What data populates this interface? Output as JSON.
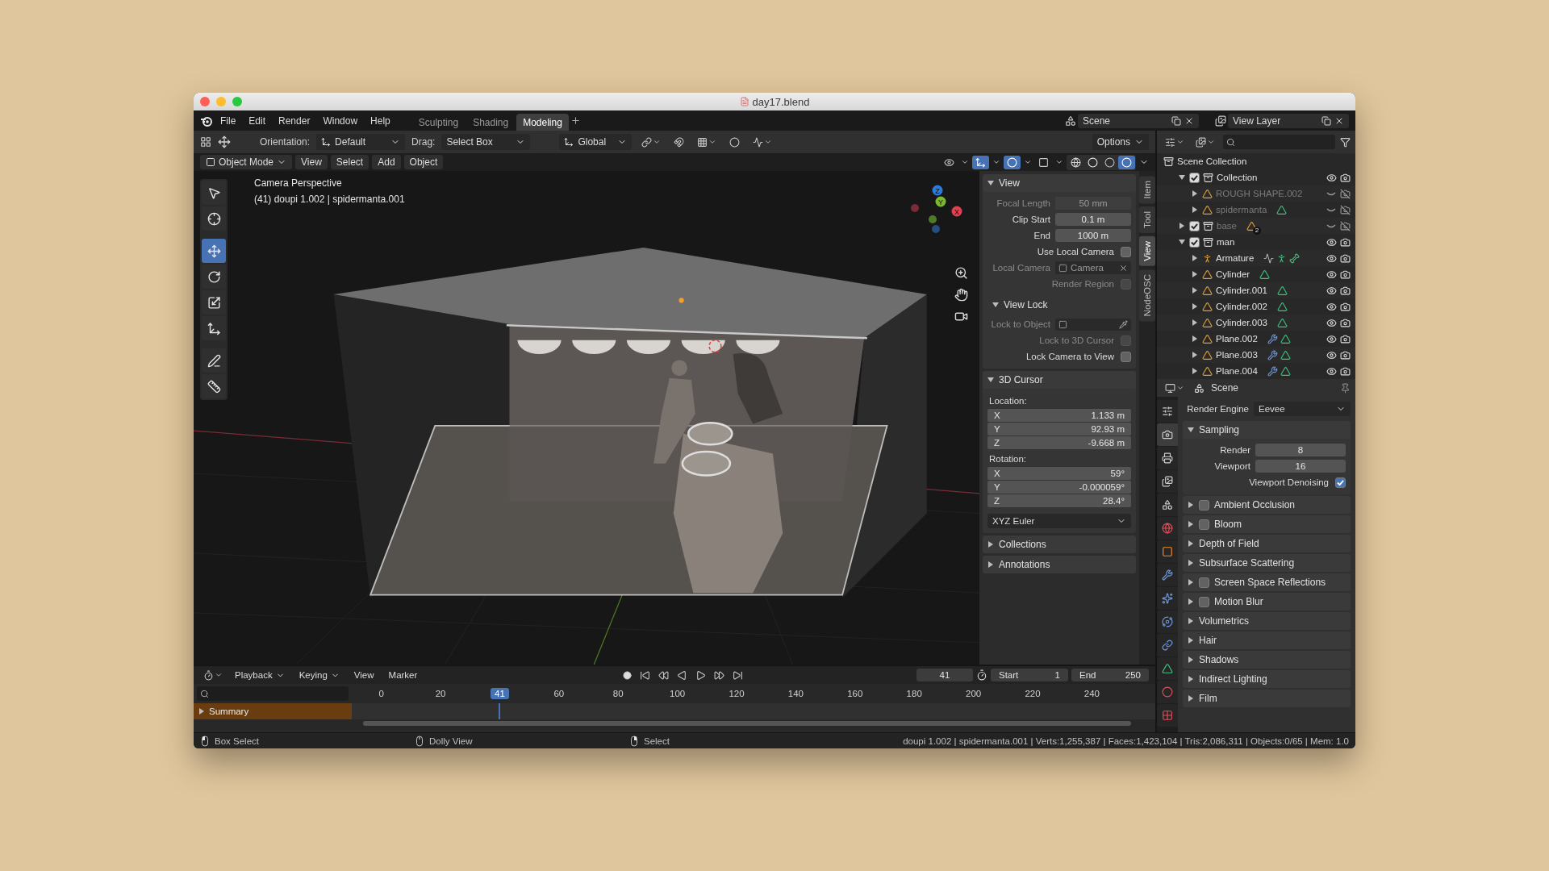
{
  "window": {
    "title": "day17.blend"
  },
  "menu_bar": {
    "menus": [
      "File",
      "Edit",
      "Render",
      "Window",
      "Help"
    ],
    "workspaces": [
      {
        "label": "Sculpting",
        "selected": false
      },
      {
        "label": "Shading",
        "selected": false
      },
      {
        "label": "Modeling",
        "selected": true
      }
    ],
    "scene": "Scene",
    "view_layer": "View Layer"
  },
  "tool_header": {
    "orientation_label": "Orientation:",
    "orientation": "Default",
    "drag_label": "Drag:",
    "drag": "Select Box",
    "transform_space": "Global",
    "options": "Options"
  },
  "viewport_header": {
    "mode": "Object Mode",
    "menus": [
      "View",
      "Select",
      "Add",
      "Object"
    ],
    "toggles": [
      {
        "kind": "visibility",
        "on": false
      },
      {
        "kind": "gizmo",
        "on": true
      },
      {
        "kind": "overlay",
        "on": true
      },
      {
        "kind": "xray",
        "on": false
      }
    ],
    "shading": [
      {
        "kind": "wireframe",
        "selected": false
      },
      {
        "kind": "solid",
        "selected": false
      },
      {
        "kind": "material",
        "selected": false
      },
      {
        "kind": "rendered",
        "selected": true
      }
    ]
  },
  "toolbar": [
    {
      "kind": "select_box",
      "selected": false
    },
    {
      "kind": "cursor",
      "selected": false
    },
    {
      "kind": "move",
      "selected": true
    },
    {
      "kind": "rotate",
      "selected": false
    },
    {
      "kind": "scale",
      "selected": false
    },
    {
      "kind": "transform",
      "selected": false
    },
    {
      "kind": "annotate",
      "selected": false
    },
    {
      "kind": "measure",
      "selected": false
    }
  ],
  "viewport": {
    "overlay_lines": [
      "Camera Perspective",
      "(41) doupi 1.002 | spidermanta.001"
    ],
    "gizmo": [
      {
        "label": "Z",
        "color": "#2e7ad8"
      },
      {
        "label": "Y",
        "color": "#7cb82f"
      },
      {
        "label": "X",
        "color": "#e0404f"
      }
    ]
  },
  "sidebar": {
    "tabs": [
      {
        "label": "Item",
        "selected": false
      },
      {
        "label": "Tool",
        "selected": false
      },
      {
        "label": "View",
        "selected": true
      },
      {
        "label": "NodeOSC",
        "selected": false
      }
    ],
    "panels": [
      {
        "title": "View",
        "expanded": true,
        "fields": [
          {
            "kind": "number",
            "label": "Focal Length",
            "value": "50 mm",
            "disabled": true
          },
          {
            "kind": "number",
            "label": "Clip Start",
            "value": "0.1 m",
            "disabled": false
          },
          {
            "kind": "number",
            "label": "End",
            "value": "1000 m",
            "disabled": false
          },
          {
            "kind": "checkbox",
            "label": "Use Local Camera",
            "checked": false,
            "disabled": false
          },
          {
            "kind": "object",
            "label": "Local Camera",
            "value": "Camera",
            "disabled": true
          },
          {
            "kind": "checkbox",
            "label": "Render Region",
            "checked": false,
            "disabled": true
          },
          {
            "kind": "subpanel",
            "label": "View Lock",
            "expanded": true
          },
          {
            "kind": "object",
            "label": "Lock to Object",
            "disabled": true
          },
          {
            "kind": "checkbox",
            "label": "Lock to 3D Cursor",
            "checked": false,
            "disabled": true
          },
          {
            "kind": "checkbox",
            "label": "Lock Camera to View",
            "checked": false,
            "disabled": false
          }
        ]
      },
      {
        "title": "3D Cursor",
        "expanded": true,
        "fields": [
          {
            "kind": "heading",
            "label": "Location:"
          },
          {
            "kind": "vector",
            "rows": [
              {
                "axis": "X",
                "value": "1.133 m"
              },
              {
                "axis": "Y",
                "value": "92.93 m"
              },
              {
                "axis": "Z",
                "value": "-9.668 m"
              }
            ]
          },
          {
            "kind": "heading",
            "label": "Rotation:"
          },
          {
            "kind": "vector",
            "rows": [
              {
                "axis": "X",
                "value": "59°"
              },
              {
                "axis": "Y",
                "value": "-0.000059°"
              },
              {
                "axis": "Z",
                "value": "28.4°"
              }
            ]
          },
          {
            "kind": "dropdown",
            "value": "XYZ Euler"
          }
        ]
      },
      {
        "title": "Collections",
        "expanded": false
      },
      {
        "title": "Annotations",
        "expanded": false
      }
    ]
  },
  "outliner": {
    "root": "Scene Collection",
    "tree": [
      {
        "name": "Collection",
        "kind": "collection",
        "expanded": true,
        "checked": true,
        "visible": true,
        "renderable": true,
        "children": [
          {
            "name": "ROUGH SHAPE.002",
            "kind": "mesh",
            "expanded": false,
            "visible": false,
            "renderable": false
          },
          {
            "name": "spidermanta",
            "kind": "mesh",
            "expanded": false,
            "visible": false,
            "renderable": false,
            "extras": [
              {
                "kind": "mesh"
              }
            ]
          }
        ]
      },
      {
        "name": "base",
        "kind": "collection",
        "expanded": false,
        "checked": true,
        "visible": false,
        "renderable": false,
        "extras": [
          {
            "kind": "objects",
            "count": "2"
          }
        ]
      },
      {
        "name": "man",
        "kind": "collection",
        "expanded": true,
        "checked": true,
        "visible": true,
        "renderable": true,
        "children": [
          {
            "name": "Armature",
            "kind": "armature",
            "expanded": false,
            "visible": true,
            "renderable": true,
            "extras": [
              {
                "kind": "action"
              },
              {
                "kind": "pose"
              },
              {
                "kind": "armature"
              }
            ]
          },
          {
            "name": "Cylinder",
            "kind": "mesh",
            "expanded": false,
            "visible": true,
            "renderable": true,
            "extras": [
              {
                "kind": "mesh"
              }
            ]
          },
          {
            "name": "Cylinder.001",
            "kind": "mesh",
            "expanded": false,
            "visible": true,
            "renderable": true,
            "extras": [
              {
                "kind": "mesh"
              }
            ]
          },
          {
            "name": "Cylinder.002",
            "kind": "mesh",
            "expanded": false,
            "visible": true,
            "renderable": true,
            "extras": [
              {
                "kind": "mesh"
              }
            ]
          },
          {
            "name": "Cylinder.003",
            "kind": "mesh",
            "expanded": false,
            "visible": true,
            "renderable": true,
            "extras": [
              {
                "kind": "mesh"
              }
            ]
          },
          {
            "name": "Plane.002",
            "kind": "mesh",
            "expanded": false,
            "visible": true,
            "renderable": true,
            "extras": [
              {
                "kind": "modifier"
              },
              {
                "kind": "mesh"
              }
            ]
          },
          {
            "name": "Plane.003",
            "kind": "mesh",
            "expanded": false,
            "visible": true,
            "renderable": true,
            "extras": [
              {
                "kind": "modifier"
              },
              {
                "kind": "mesh"
              }
            ]
          },
          {
            "name": "Plane.004",
            "kind": "mesh",
            "expanded": false,
            "visible": true,
            "renderable": true,
            "extras": [
              {
                "kind": "modifier"
              },
              {
                "kind": "mesh"
              }
            ]
          }
        ]
      }
    ]
  },
  "properties": {
    "context": "Scene",
    "tabs": [
      {
        "kind": "tool",
        "selected": false
      },
      {
        "kind": "render",
        "selected": true
      },
      {
        "kind": "output",
        "selected": false
      },
      {
        "kind": "view_layer",
        "selected": false
      },
      {
        "kind": "scene",
        "selected": false
      },
      {
        "kind": "world",
        "selected": false
      },
      {
        "kind": "object",
        "selected": false
      },
      {
        "kind": "modifiers",
        "selected": false
      },
      {
        "kind": "particles",
        "selected": false
      },
      {
        "kind": "physics",
        "selected": false
      },
      {
        "kind": "constraints",
        "selected": false
      },
      {
        "kind": "data",
        "selected": false
      },
      {
        "kind": "material",
        "selected": false
      },
      {
        "kind": "texture",
        "selected": false
      }
    ],
    "render_engine": {
      "label": "Render Engine",
      "value": "Eevee"
    },
    "panels": [
      {
        "title": "Sampling",
        "expanded": true,
        "fields": [
          {
            "kind": "number",
            "label": "Render",
            "value": "8"
          },
          {
            "kind": "number",
            "label": "Viewport",
            "value": "16"
          },
          {
            "kind": "checkbox",
            "label": "Viewport Denoising",
            "checked": true
          }
        ]
      },
      {
        "title": "Ambient Occlusion",
        "expanded": false,
        "enabled": false
      },
      {
        "title": "Bloom",
        "expanded": false,
        "enabled": false
      },
      {
        "title": "Depth of Field",
        "expanded": false
      },
      {
        "title": "Subsurface Scattering",
        "expanded": false
      },
      {
        "title": "Screen Space Reflections",
        "expanded": false,
        "enabled": false
      },
      {
        "title": "Motion Blur",
        "expanded": false,
        "enabled": false
      },
      {
        "title": "Volumetrics",
        "expanded": false
      },
      {
        "title": "Hair",
        "expanded": false
      },
      {
        "title": "Shadows",
        "expanded": false
      },
      {
        "title": "Indirect Lighting",
        "expanded": false
      },
      {
        "title": "Film",
        "expanded": false
      }
    ]
  },
  "timeline": {
    "menus": [
      {
        "label": "Playback",
        "dropdown": true
      },
      {
        "label": "Keying",
        "dropdown": true
      },
      {
        "label": "View",
        "dropdown": false
      },
      {
        "label": "Marker",
        "dropdown": false
      }
    ],
    "current_frame": "41",
    "start_label": "Start",
    "start": "1",
    "end_label": "End",
    "end": "250",
    "ruler": [
      {
        "kind": "tick",
        "label": "0"
      },
      {
        "kind": "tick",
        "label": "20"
      },
      {
        "kind": "playhead",
        "label": "41"
      },
      {
        "kind": "tick",
        "label": "60"
      },
      {
        "kind": "tick",
        "label": "80"
      },
      {
        "kind": "tick",
        "label": "100"
      },
      {
        "kind": "tick",
        "label": "120"
      },
      {
        "kind": "tick",
        "label": "140"
      },
      {
        "kind": "tick",
        "label": "160"
      },
      {
        "kind": "tick",
        "label": "180"
      },
      {
        "kind": "tick",
        "label": "200"
      },
      {
        "kind": "tick",
        "label": "220"
      },
      {
        "kind": "tick",
        "label": "240"
      }
    ],
    "channels": [
      {
        "label": "Summary",
        "expanded": false
      }
    ]
  },
  "status_bar": {
    "hints": [
      {
        "kind": "mouse_left",
        "label": "Box Select"
      },
      {
        "kind": "mouse_middle",
        "label": "Dolly View"
      },
      {
        "kind": "mouse_right",
        "label": "Select"
      }
    ],
    "stats": "doupi 1.002 | spidermanta.001 | Verts:1,255,387 | Faces:1,423,104 | Tris:2,086,311 | Objects:0/65 | Mem: 1.0"
  }
}
